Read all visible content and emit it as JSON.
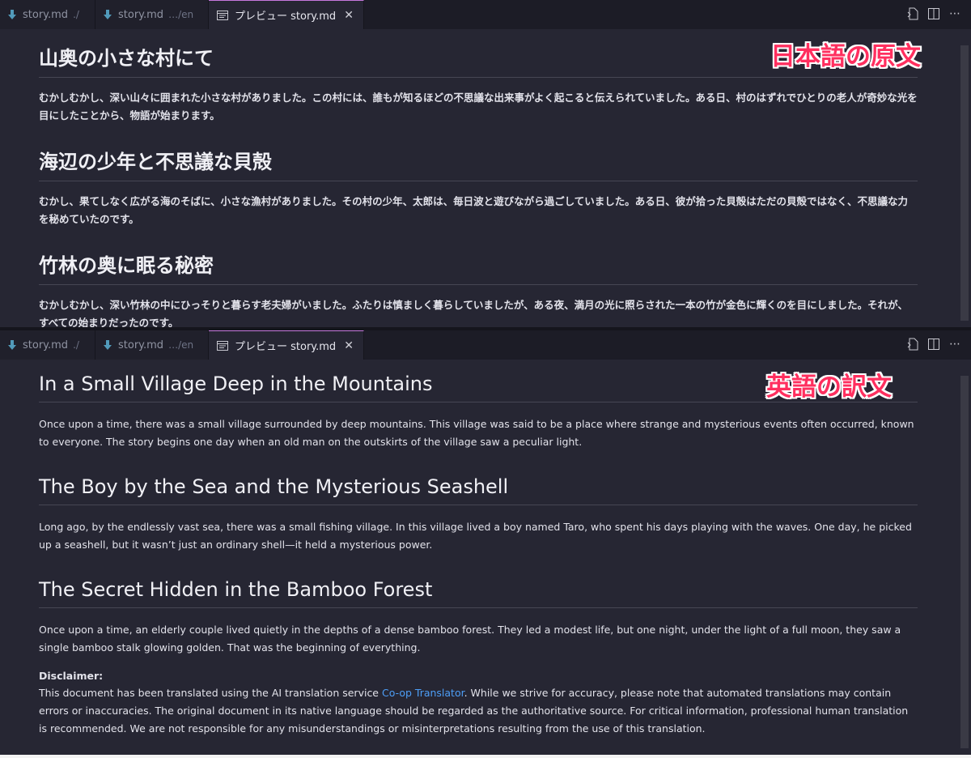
{
  "top": {
    "tabs": [
      {
        "name": "story.md",
        "hint": "./"
      },
      {
        "name": "story.md",
        "hint": "…/en"
      },
      {
        "name": "プレビュー story.md",
        "close": "✕"
      }
    ],
    "annotation": "日本語の原文",
    "sections": [
      {
        "heading": "山奥の小さな村にて",
        "body": "むかしむかし、深い山々に囲まれた小さな村がありました。この村には、誰もが知るほどの不思議な出来事がよく起こると伝えられていました。ある日、村のはずれでひとりの老人が奇妙な光を目にしたことから、物語が始まります。"
      },
      {
        "heading": "海辺の少年と不思議な貝殻",
        "body": "むかし、果てしなく広がる海のそばに、小さな漁村がありました。その村の少年、太郎は、毎日波と遊びながら過ごしていました。ある日、彼が拾った貝殻はただの貝殻ではなく、不思議な力を秘めていたのです。"
      },
      {
        "heading": "竹林の奥に眠る秘密",
        "body": "むかしむかし、深い竹林の中にひっそりと暮らす老夫婦がいました。ふたりは慎ましく暮らしていましたが、ある夜、満月の光に照らされた一本の竹が金色に輝くのを目にしました。それが、すべての始まりだったのです。"
      }
    ]
  },
  "bottom": {
    "tabs": [
      {
        "name": "story.md",
        "hint": "./"
      },
      {
        "name": "story.md",
        "hint": "…/en"
      },
      {
        "name": "プレビュー story.md",
        "close": "✕"
      }
    ],
    "annotation": "英語の訳文",
    "sections": [
      {
        "heading": "In a Small Village Deep in the Mountains",
        "body": "Once upon a time, there was a small village surrounded by deep mountains. This village was said to be a place where strange and mysterious events often occurred, known to everyone. The story begins one day when an old man on the outskirts of the village saw a peculiar light."
      },
      {
        "heading": "The Boy by the Sea and the Mysterious Seashell",
        "body": "Long ago, by the endlessly vast sea, there was a small fishing village. In this village lived a boy named Taro, who spent his days playing with the waves. One day, he picked up a seashell, but it wasn’t just an ordinary shell—it held a mysterious power."
      },
      {
        "heading": "The Secret Hidden in the Bamboo Forest",
        "body": "Once upon a time, an elderly couple lived quietly in the depths of a dense bamboo forest. They led a modest life, but one night, under the light of a full moon, they saw a single bamboo stalk glowing golden. That was the beginning of everything."
      }
    ],
    "disclaimer": {
      "title": "Disclaimer:",
      "before_link": "This document has been translated using the AI translation service ",
      "link": "Co-op Translator",
      "after_link": ". While we strive for accuracy, please note that automated translations may contain errors or inaccuracies. The original document in its native language should be regarded as the authoritative source. For critical information, professional human translation is recommended. We are not responsible for any misunderstandings or misinterpretations resulting from the use of this translation."
    }
  },
  "colors": {
    "background": "#262633",
    "tabbar": "#1c1c26",
    "annotation": "#ff2f5f",
    "link": "#4d9ef7",
    "active_tab_border": "#c678dd",
    "md_icon": "#519aba"
  },
  "icons": {
    "markdown_tab": "markdown-arrow-icon",
    "preview_tab": "preview-icon",
    "close": "close-icon",
    "open_source": "open-source-icon",
    "split": "split-editor-icon",
    "more": "more-actions-icon"
  }
}
